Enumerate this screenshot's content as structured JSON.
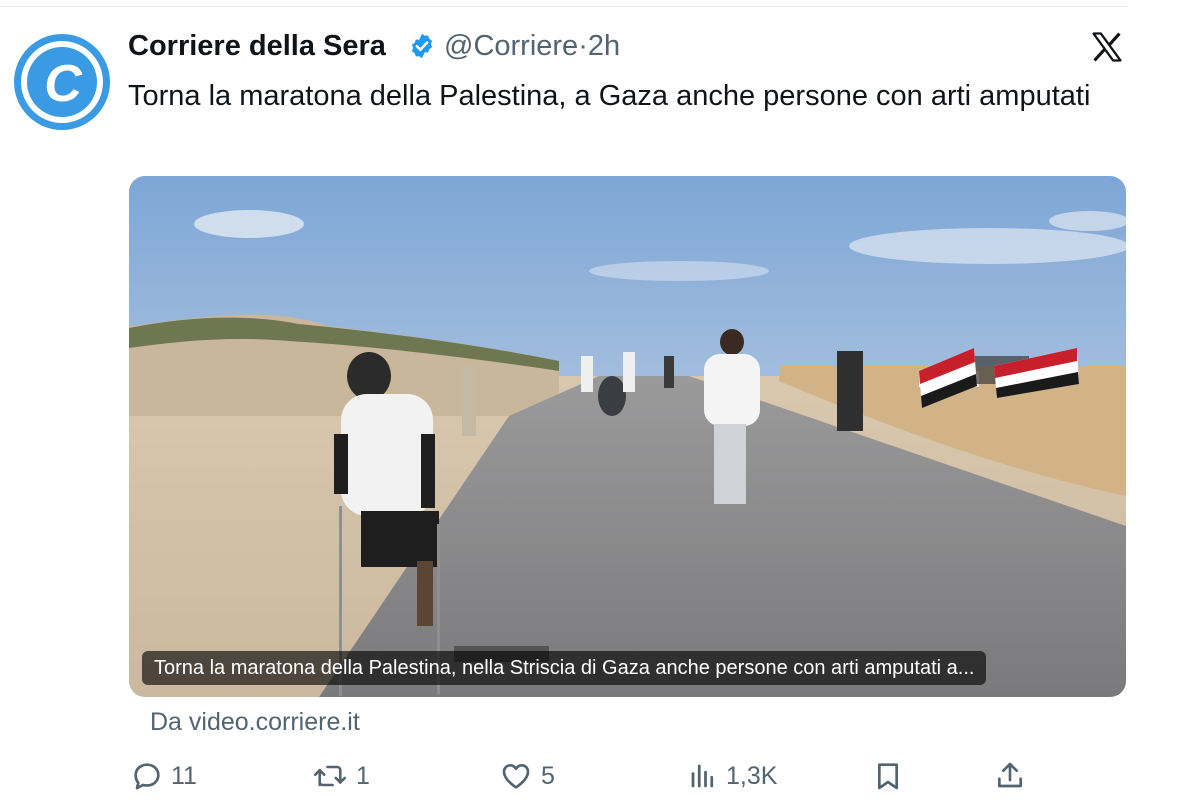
{
  "author": {
    "name": "Corriere della Sera",
    "handle": "@Corriere",
    "separator": "·",
    "time": "2h",
    "avatar_letter": "C"
  },
  "tweet": {
    "text": "Torna la maratona della Palestina, a Gaza anche persone con arti amputati"
  },
  "media": {
    "caption": "Torna la maratona della Palestina, nella Striscia di Gaza anche persone con arti amputati a..."
  },
  "source": {
    "text": "Da video.corriere.it"
  },
  "actions": {
    "replies": "11",
    "reposts": "1",
    "likes": "5",
    "views": "1,3K"
  },
  "icons": {
    "verified": "verified-badge-icon",
    "platform": "x-logo-icon",
    "reply": "reply-icon",
    "repost": "repost-icon",
    "like": "heart-icon",
    "views": "views-icon",
    "bookmark": "bookmark-icon",
    "share": "share-icon"
  },
  "colors": {
    "avatar_blue": "#3a9be4",
    "verified_blue": "#1d9bf0",
    "text_primary": "#0f1419",
    "text_secondary": "#536471"
  }
}
